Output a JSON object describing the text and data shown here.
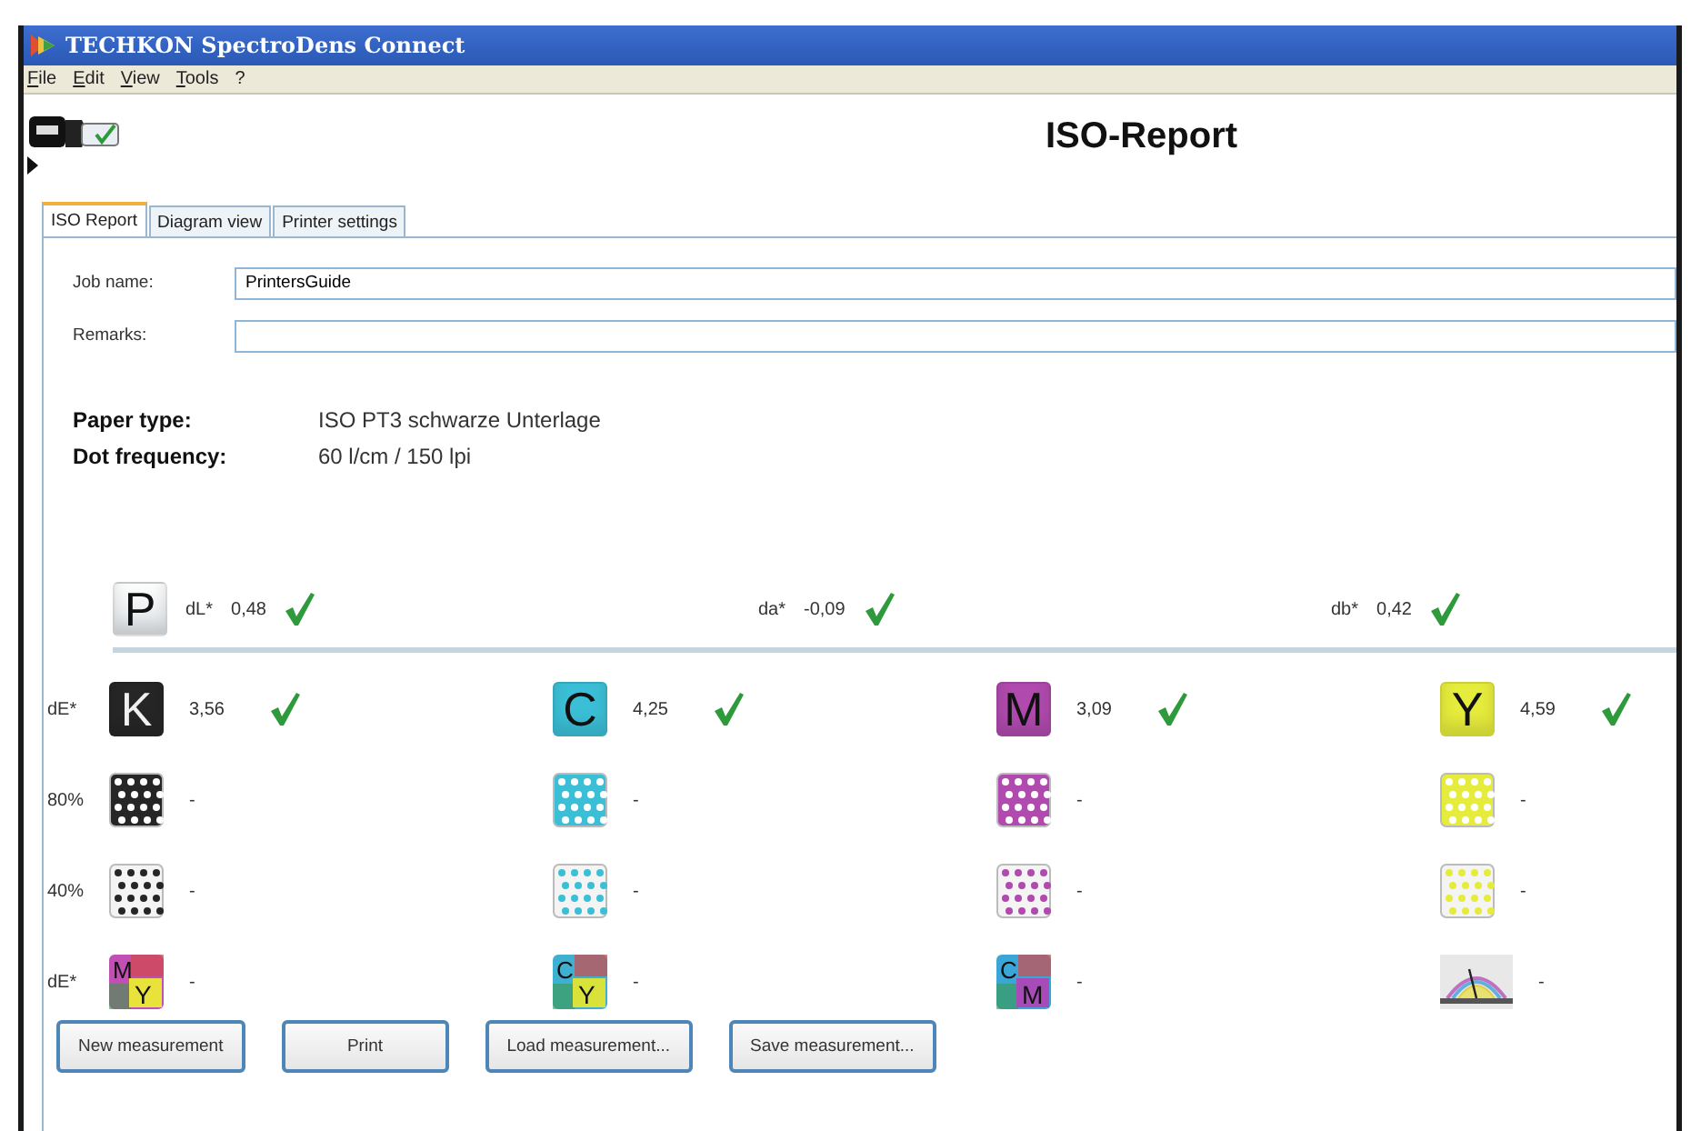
{
  "window": {
    "title": "TECHKON SpectroDens Connect"
  },
  "menu": [
    {
      "label": "File"
    },
    {
      "label": "Edit"
    },
    {
      "label": "View"
    },
    {
      "label": "Tools"
    },
    {
      "label": "?"
    }
  ],
  "report_title": "ISO-Report",
  "tabs": [
    {
      "label": "ISO Report",
      "selected": true
    },
    {
      "label": "Diagram view",
      "selected": false
    },
    {
      "label": "Printer settings",
      "selected": false
    }
  ],
  "fields": [
    {
      "label": "Job name:",
      "value": "PrintersGuide"
    },
    {
      "label": "Remarks:"
    }
  ],
  "info": [
    {
      "label": "Paper type:",
      "value": "ISO PT3 schwarze Unterlage"
    },
    {
      "label": "Dot frequency:",
      "value": "60 l/cm / 150 lpi"
    }
  ],
  "paper": {
    "letter": "P",
    "measurements": [
      {
        "label": "dL*",
        "value": "0,48",
        "passed": true
      },
      {
        "label": "da*",
        "value": "-0,09",
        "passed": true
      },
      {
        "label": "db*",
        "value": "0,42",
        "passed": true
      }
    ]
  },
  "inks": [
    {
      "color": "#262626"
    },
    {
      "color": "#3bbfd6"
    },
    {
      "color": "#b04aae"
    },
    {
      "color": "#e6ec3c"
    }
  ],
  "rows": [
    {
      "label": "dE*",
      "cells": [
        {
          "kind": "solid",
          "letter": "K",
          "value": "3,56",
          "passed": true
        },
        {
          "kind": "solid",
          "letter": "C",
          "value": "4,25",
          "passed": true
        },
        {
          "kind": "solid",
          "letter": "M",
          "value": "3,09",
          "passed": true
        },
        {
          "kind": "solid",
          "letter": "Y",
          "value": "4,59",
          "passed": true
        }
      ]
    },
    {
      "label": "80%",
      "cells": [
        {
          "kind": "dense_tint",
          "value": "-"
        },
        {
          "kind": "dense_tint",
          "value": "-"
        },
        {
          "kind": "dense_tint",
          "value": "-"
        },
        {
          "kind": "dense_tint",
          "value": "-"
        }
      ]
    },
    {
      "label": "40%",
      "cells": [
        {
          "kind": "light_tint",
          "value": "-"
        },
        {
          "kind": "light_tint",
          "value": "-"
        },
        {
          "kind": "light_tint",
          "value": "-"
        },
        {
          "kind": "light_tint",
          "value": "-"
        }
      ]
    },
    {
      "label": "dE*",
      "cells": [
        {
          "kind": "overprint",
          "letters": [
            "M",
            "Y"
          ],
          "value": "-"
        },
        {
          "kind": "overprint",
          "letters": [
            "C",
            "Y"
          ],
          "value": "-"
        },
        {
          "kind": "overprint",
          "letters": [
            "C",
            "M"
          ],
          "value": "-"
        },
        {
          "kind": "gauge",
          "value": "-"
        }
      ]
    }
  ],
  "buttons": [
    {
      "label": "New measurement"
    },
    {
      "label": "Print"
    },
    {
      "label": "Load measurement..."
    },
    {
      "label": "Save measurement..."
    }
  ]
}
